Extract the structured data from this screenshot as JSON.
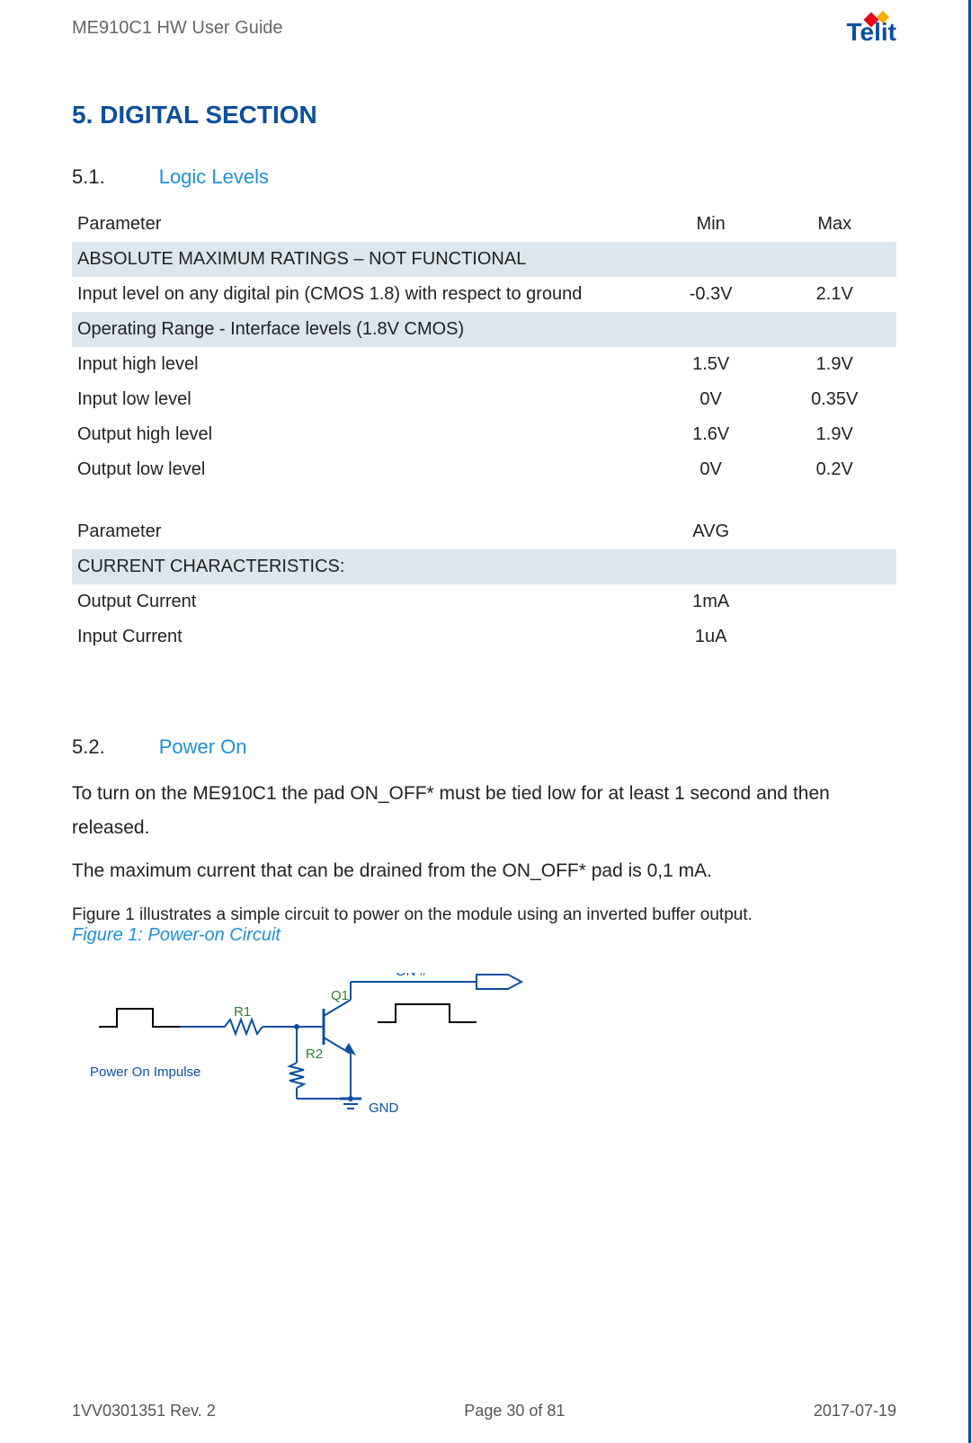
{
  "header": {
    "doc_title": "ME910C1 HW User Guide",
    "logo_text": "Telit"
  },
  "section": {
    "number": "5.",
    "title": "DIGITAL SECTION"
  },
  "sub1": {
    "number": "5.1.",
    "title": "Logic Levels"
  },
  "table1": {
    "head_param": "Parameter",
    "head_min": "Min",
    "head_max": "Max",
    "subhead1": "ABSOLUTE MAXIMUM RATINGS – NOT FUNCTIONAL",
    "row1": {
      "param": "Input level on any digital pin (CMOS 1.8) with respect to ground",
      "min": "-0.3V",
      "max": "2.1V"
    },
    "subhead2": "Operating Range - Interface levels (1.8V CMOS)",
    "row2": {
      "param": "Input high level",
      "min": "1.5V",
      "max": "1.9V"
    },
    "row3": {
      "param": "Input low level",
      "min": "0V",
      "max": "0.35V"
    },
    "row4": {
      "param": "Output high level",
      "min": "1.6V",
      "max": "1.9V"
    },
    "row5": {
      "param": "Output low level",
      "min": "0V",
      "max": "0.2V"
    }
  },
  "table2": {
    "head_param": "Parameter",
    "head_avg": "AVG",
    "subhead": "CURRENT CHARACTERISTICS:",
    "row1": {
      "param": "Output Current",
      "avg": "1mA"
    },
    "row2": {
      "param": "Input Current",
      "avg": "1uA"
    }
  },
  "sub2": {
    "number": "5.2.",
    "title": "Power On"
  },
  "body": {
    "p1": "To turn on the ME910C1 the pad ON_OFF* must be tied low for at least 1 second and then released.",
    "p2": "The maximum current that can be drained from the ON_OFF* pad is 0,1 mA.",
    "fig_intro": "Figure 1 illustrates a simple circuit to power on the module using an inverted buffer output.",
    "fig_caption": "Figure 1: Power-on Circuit"
  },
  "circuit_labels": {
    "power_on": "Power On Impulse",
    "r1": "R1",
    "r2": "R2",
    "q1": "Q1",
    "on": "ON #",
    "gnd": "GND"
  },
  "footer": {
    "left": "1VV0301351 Rev. 2",
    "center": "Page 30 of 81",
    "right": "2017-07-19"
  }
}
